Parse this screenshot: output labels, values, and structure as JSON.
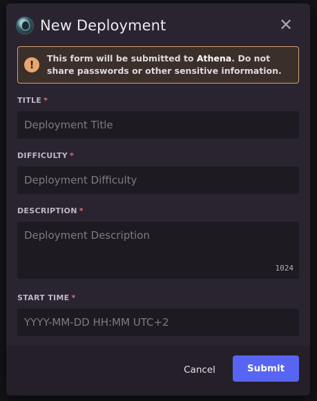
{
  "modal": {
    "title": "New Deployment",
    "close_label": "✕"
  },
  "warning": {
    "text_before": "This form will be submitted to ",
    "app_name": "Athena",
    "text_after": ". Do not share passwords or other sensitive information.",
    "icon_glyph": "!"
  },
  "fields": {
    "title": {
      "label": "TITLE",
      "required_mark": "*",
      "placeholder": "Deployment Title",
      "value": ""
    },
    "difficulty": {
      "label": "DIFFICULTY",
      "required_mark": "*",
      "placeholder": "Deployment Difficulty",
      "value": ""
    },
    "description": {
      "label": "DESCRIPTION",
      "required_mark": "*",
      "placeholder": "Deployment Description",
      "value": "",
      "char_remaining": "1024"
    },
    "start_time": {
      "label": "START TIME",
      "required_mark": "*",
      "placeholder": "YYYY-MM-DD HH:MM UTC+2",
      "value": ""
    }
  },
  "footer": {
    "cancel_label": "Cancel",
    "submit_label": "Submit"
  },
  "colors": {
    "accent": "#5865f2",
    "warning_border": "#d4a372",
    "required": "#e86c75"
  }
}
